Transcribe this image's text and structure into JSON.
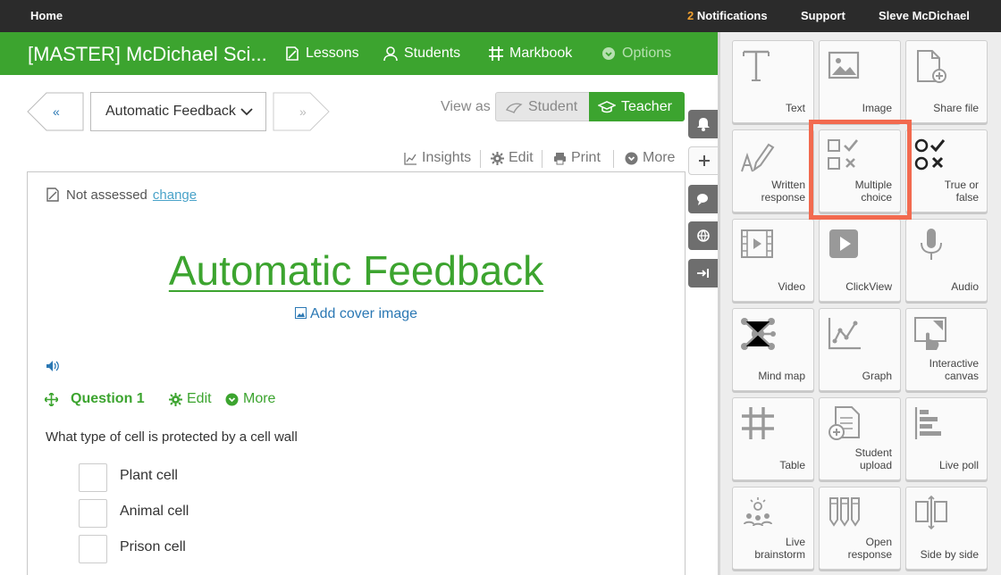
{
  "topbar": {
    "home": "Home",
    "notification_count": "2",
    "notifications": "Notifications",
    "support": "Support",
    "user": "Sleve McDichael"
  },
  "course": {
    "title": "[MASTER] McDichael Sci...",
    "nav": {
      "lessons": "Lessons",
      "students": "Students",
      "markbook": "Markbook",
      "options": "Options"
    }
  },
  "page_nav": {
    "prev": "«",
    "next": "»",
    "selected_page": "Automatic Feedback"
  },
  "view_as": {
    "label": "View as",
    "student": "Student",
    "teacher": "Teacher",
    "active": "Teacher"
  },
  "tools": {
    "insights": "Insights",
    "edit": "Edit",
    "print": "Print",
    "more": "More"
  },
  "content": {
    "assessment_status": "Not assessed",
    "change_link": "change",
    "page_title": "Automatic Feedback",
    "add_cover": "Add cover image",
    "question": {
      "label": "Question 1",
      "edit": "Edit",
      "more": "More",
      "text": "What type of cell is protected by a cell wall",
      "options": [
        "Plant cell",
        "Animal cell",
        "Prison cell"
      ]
    }
  },
  "panel": {
    "highlighted": "Multiple\nchoice",
    "accent_color": "#f26a4f",
    "tiles": [
      {
        "label": "Text",
        "icon": "text-icon"
      },
      {
        "label": "Image",
        "icon": "image-icon"
      },
      {
        "label": "Share file",
        "icon": "share-file-icon"
      },
      {
        "label": "Written\nresponse",
        "icon": "written-response-icon"
      },
      {
        "label": "Multiple\nchoice",
        "icon": "multiple-choice-icon"
      },
      {
        "label": "True or\nfalse",
        "icon": "true-false-icon"
      },
      {
        "label": "Video",
        "icon": "video-icon"
      },
      {
        "label": "ClickView",
        "icon": "clickview-icon"
      },
      {
        "label": "Audio",
        "icon": "microphone-icon"
      },
      {
        "label": "Mind map",
        "icon": "mind-map-icon"
      },
      {
        "label": "Graph",
        "icon": "graph-icon"
      },
      {
        "label": "Interactive\ncanvas",
        "icon": "interactive-canvas-icon"
      },
      {
        "label": "Table",
        "icon": "table-icon"
      },
      {
        "label": "Student\nupload",
        "icon": "student-upload-icon"
      },
      {
        "label": "Live poll",
        "icon": "live-poll-icon"
      },
      {
        "label": "Live\nbrainstorm",
        "icon": "live-brainstorm-icon"
      },
      {
        "label": "Open\nresponse",
        "icon": "open-response-icon"
      },
      {
        "label": "Side by side",
        "icon": "side-by-side-icon"
      }
    ]
  },
  "colors": {
    "brand_green": "#3ca42f",
    "topbar": "#2b2b2b",
    "link_blue": "#2b78b4"
  }
}
